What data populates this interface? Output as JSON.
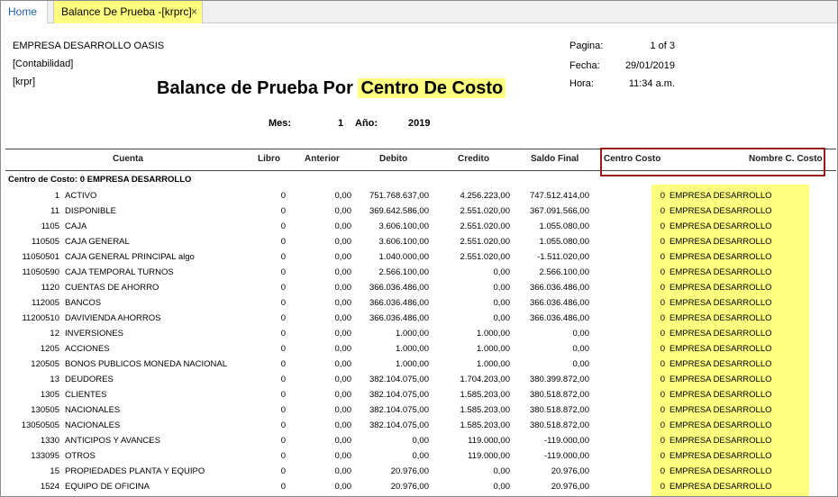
{
  "tabs": {
    "home": "Home",
    "active": "Balance De Prueba -[krprc]",
    "close": "×"
  },
  "report": {
    "company": "EMPRESA DESARROLLO OASIS",
    "context1": "[Contabilidad]",
    "context2": "[krpr]",
    "title_plain": "Balance de Prueba Por",
    "title_highlight": "Centro De Costo",
    "pagina_label": "Pagina:",
    "pagina_value": "1 of 3",
    "fecha_label": "Fecha:",
    "fecha_value": "29/01/2019",
    "hora_label": "Hora:",
    "hora_value": "11:34 a.m.",
    "mes_label": "Mes:",
    "mes_value": "1",
    "ano_label": "Año:",
    "ano_value": "2019"
  },
  "columns": {
    "cuenta": "Cuenta",
    "libro": "Libro",
    "anterior": "Anterior",
    "debito": "Debito",
    "credito": "Credito",
    "saldo": "Saldo Final",
    "centro_costo": "Centro Costo",
    "nombre_cc": "Nombre C. Costo"
  },
  "group_header": "Centro de Costo: 0 EMPRESA DESARROLLO",
  "rows": [
    {
      "code": "1",
      "name": "ACTIVO",
      "libro": "0",
      "anterior": "0,00",
      "debito": "751.768.637,00",
      "credito": "4.256.223,00",
      "saldo": "747.512.414,00",
      "cc": "0",
      "cc_name": "EMPRESA DESARROLLO"
    },
    {
      "code": "11",
      "name": "DISPONIBLE",
      "libro": "0",
      "anterior": "0,00",
      "debito": "369.642.586,00",
      "credito": "2.551.020,00",
      "saldo": "367.091.566,00",
      "cc": "0",
      "cc_name": "EMPRESA DESARROLLO"
    },
    {
      "code": "1105",
      "name": "CAJA",
      "libro": "0",
      "anterior": "0,00",
      "debito": "3.606.100,00",
      "credito": "2.551.020,00",
      "saldo": "1.055.080,00",
      "cc": "0",
      "cc_name": "EMPRESA DESARROLLO"
    },
    {
      "code": "110505",
      "name": "CAJA GENERAL",
      "libro": "0",
      "anterior": "0,00",
      "debito": "3.606.100,00",
      "credito": "2.551.020,00",
      "saldo": "1.055.080,00",
      "cc": "0",
      "cc_name": "EMPRESA DESARROLLO"
    },
    {
      "code": "11050501",
      "name": "CAJA GENERAL PRINCIPAL algo",
      "libro": "0",
      "anterior": "0,00",
      "debito": "1.040.000,00",
      "credito": "2.551.020,00",
      "saldo": "-1.511.020,00",
      "cc": "0",
      "cc_name": "EMPRESA DESARROLLO"
    },
    {
      "code": "11050590",
      "name": "CAJA TEMPORAL TURNOS",
      "libro": "0",
      "anterior": "0,00",
      "debito": "2.566.100,00",
      "credito": "0,00",
      "saldo": "2.566.100,00",
      "cc": "0",
      "cc_name": "EMPRESA DESARROLLO"
    },
    {
      "code": "1120",
      "name": "CUENTAS DE AHORRO",
      "libro": "0",
      "anterior": "0,00",
      "debito": "366.036.486,00",
      "credito": "0,00",
      "saldo": "366.036.486,00",
      "cc": "0",
      "cc_name": "EMPRESA DESARROLLO"
    },
    {
      "code": "112005",
      "name": "BANCOS",
      "libro": "0",
      "anterior": "0,00",
      "debito": "366.036.486,00",
      "credito": "0,00",
      "saldo": "366.036.486,00",
      "cc": "0",
      "cc_name": "EMPRESA DESARROLLO"
    },
    {
      "code": "11200510",
      "name": "DAVIVIENDA AHORROS",
      "libro": "0",
      "anterior": "0,00",
      "debito": "366.036.486,00",
      "credito": "0,00",
      "saldo": "366.036.486,00",
      "cc": "0",
      "cc_name": "EMPRESA DESARROLLO"
    },
    {
      "code": "12",
      "name": "INVERSIONES",
      "libro": "0",
      "anterior": "0,00",
      "debito": "1.000,00",
      "credito": "1.000,00",
      "saldo": "0,00",
      "cc": "0",
      "cc_name": "EMPRESA DESARROLLO"
    },
    {
      "code": "1205",
      "name": "ACCIONES",
      "libro": "0",
      "anterior": "0,00",
      "debito": "1.000,00",
      "credito": "1.000,00",
      "saldo": "0,00",
      "cc": "0",
      "cc_name": "EMPRESA DESARROLLO"
    },
    {
      "code": "120505",
      "name": "BONOS PUBLICOS MONEDA NACIONAL",
      "libro": "0",
      "anterior": "0,00",
      "debito": "1.000,00",
      "credito": "1.000,00",
      "saldo": "0,00",
      "cc": "0",
      "cc_name": "EMPRESA DESARROLLO"
    },
    {
      "code": "13",
      "name": "DEUDORES",
      "libro": "0",
      "anterior": "0,00",
      "debito": "382.104.075,00",
      "credito": "1.704.203,00",
      "saldo": "380.399.872,00",
      "cc": "0",
      "cc_name": "EMPRESA DESARROLLO"
    },
    {
      "code": "1305",
      "name": "CLIENTES",
      "libro": "0",
      "anterior": "0,00",
      "debito": "382.104.075,00",
      "credito": "1.585.203,00",
      "saldo": "380.518.872,00",
      "cc": "0",
      "cc_name": "EMPRESA DESARROLLO"
    },
    {
      "code": "130505",
      "name": "NACIONALES",
      "libro": "0",
      "anterior": "0,00",
      "debito": "382.104.075,00",
      "credito": "1.585.203,00",
      "saldo": "380.518.872,00",
      "cc": "0",
      "cc_name": "EMPRESA DESARROLLO"
    },
    {
      "code": "13050505",
      "name": "NACIONALES",
      "libro": "0",
      "anterior": "0,00",
      "debito": "382.104.075,00",
      "credito": "1.585.203,00",
      "saldo": "380.518.872,00",
      "cc": "0",
      "cc_name": "EMPRESA DESARROLLO"
    },
    {
      "code": "1330",
      "name": "ANTICIPOS Y AVANCES",
      "libro": "0",
      "anterior": "0,00",
      "debito": "0,00",
      "credito": "119.000,00",
      "saldo": "-119.000,00",
      "cc": "0",
      "cc_name": "EMPRESA DESARROLLO"
    },
    {
      "code": "133095",
      "name": "OTROS",
      "libro": "0",
      "anterior": "0,00",
      "debito": "0,00",
      "credito": "119.000,00",
      "saldo": "-119.000,00",
      "cc": "0",
      "cc_name": "EMPRESA DESARROLLO"
    },
    {
      "code": "15",
      "name": "PROPIEDADES PLANTA Y EQUIPO",
      "libro": "0",
      "anterior": "0,00",
      "debito": "20.976,00",
      "credito": "0,00",
      "saldo": "20.976,00",
      "cc": "0",
      "cc_name": "EMPRESA DESARROLLO"
    },
    {
      "code": "1524",
      "name": "EQUIPO DE OFICINA",
      "libro": "0",
      "anterior": "0,00",
      "debito": "20.976,00",
      "credito": "0,00",
      "saldo": "20.976,00",
      "cc": "0",
      "cc_name": "EMPRESA DESARROLLO"
    }
  ]
}
